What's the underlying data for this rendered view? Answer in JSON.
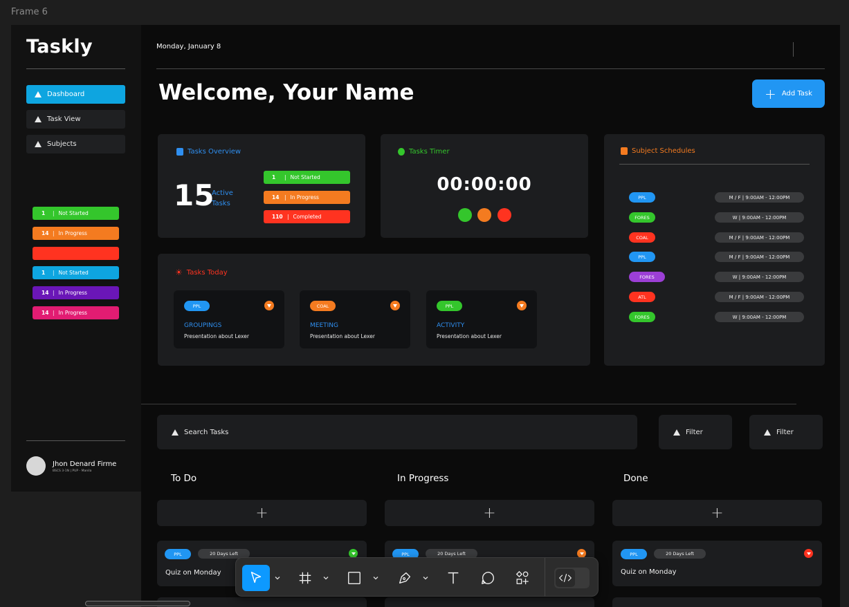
{
  "frame": {
    "label": "Frame 6"
  },
  "sidebar": {
    "logo": "Taskly",
    "nav": [
      {
        "label": "Dashboard",
        "active": true
      },
      {
        "label": "Task View",
        "active": false
      },
      {
        "label": "Subjects",
        "active": false
      }
    ],
    "status_bars": [
      {
        "count": "1",
        "label": "Not Started",
        "color": "#34c62c"
      },
      {
        "count": "14",
        "label": "In Progress",
        "color": "#f47b20"
      },
      {
        "count": "",
        "label": "",
        "color": "#ff3320"
      },
      {
        "count": "1",
        "label": "Not Started",
        "color": "#0ea5e0"
      },
      {
        "count": "14",
        "label": "In Progress",
        "color": "#6a16b7"
      },
      {
        "count": "14",
        "label": "In Progress",
        "color": "#e21c72"
      }
    ],
    "user": {
      "name": "Jhon Denard Firme",
      "subtitle": "BSCS 3-1N  |  PUP - Manila"
    }
  },
  "header": {
    "date": "Monday, January 8",
    "welcome": "Welcome, Your Name",
    "add_task": "Add Task"
  },
  "overview": {
    "title": "Tasks Overview",
    "count": "15",
    "active_label_1": "Active",
    "active_label_2": "Tasks",
    "statuses": [
      {
        "count": "1",
        "label": "Not Started",
        "color": "#34c62c"
      },
      {
        "count": "14",
        "label": "In Progress",
        "color": "#f47b20"
      },
      {
        "count": "110",
        "label": "Completed",
        "color": "#ff3320"
      }
    ]
  },
  "timer": {
    "title": "Tasks Timer",
    "value": "00:00:00",
    "dots": [
      "#34c62c",
      "#f47b20",
      "#ff3320"
    ]
  },
  "schedules": {
    "title": "Subject Schedules",
    "rows": [
      {
        "subject": "PPL",
        "color": "#2196f3",
        "time": "M / F  |  9:00AM - 12:00PM"
      },
      {
        "subject": "FORES",
        "color": "#34c62c",
        "time": "W  |  9:00AM - 12:00PM"
      },
      {
        "subject": "COAL",
        "color": "#ff3320",
        "time": "M / F  |  9:00AM - 12:00PM"
      },
      {
        "subject": "PPL",
        "color": "#2196f3",
        "time": "M / F  |  9:00AM - 12:00PM"
      },
      {
        "subject": "FORES",
        "color": "#9c3fd6",
        "time": "W  |  9:00AM - 12:00PM"
      },
      {
        "subject": "ATL",
        "color": "#ff3320",
        "time": "M / F  |  9:00AM - 12:00PM"
      },
      {
        "subject": "FORES",
        "color": "#34c62c",
        "time": "W  |  9:00AM - 12:00PM"
      }
    ]
  },
  "today": {
    "title": "Tasks Today",
    "cards": [
      {
        "tag": "PPL",
        "tag_color": "#2196f3",
        "title": "GROUPINGS",
        "desc": "Presentation about Lexer"
      },
      {
        "tag": "COAL",
        "tag_color": "#f47b20",
        "title": "MEETING",
        "desc": "Presentation about Lexer"
      },
      {
        "tag": "PPL",
        "tag_color": "#34c62c",
        "title": "ACTIVITY",
        "desc": "Presentation about Lexer"
      }
    ]
  },
  "board": {
    "search_placeholder": "Search Tasks",
    "filter_1": "Filter",
    "filter_2": "Filter",
    "add_symbol": "+",
    "columns": [
      {
        "title": "To Do",
        "card": {
          "tag": "PPL",
          "days": "20 Days Left",
          "title": "Quiz on Monday",
          "dot": "#34c62c"
        }
      },
      {
        "title": "In Progress",
        "card": {
          "tag": "PPL",
          "days": "20 Days Left",
          "title": "",
          "dot": "#f47b20"
        }
      },
      {
        "title": "Done",
        "card": {
          "tag": "PPL",
          "days": "20 Days Left",
          "title": "Quiz on Monday",
          "dot": "#ff3320"
        }
      }
    ]
  },
  "toolbar": {
    "tools": [
      "move-icon",
      "frame-icon",
      "rectangle-icon",
      "pen-icon",
      "text-icon",
      "comment-icon",
      "components-icon",
      "dev-mode-icon"
    ]
  }
}
